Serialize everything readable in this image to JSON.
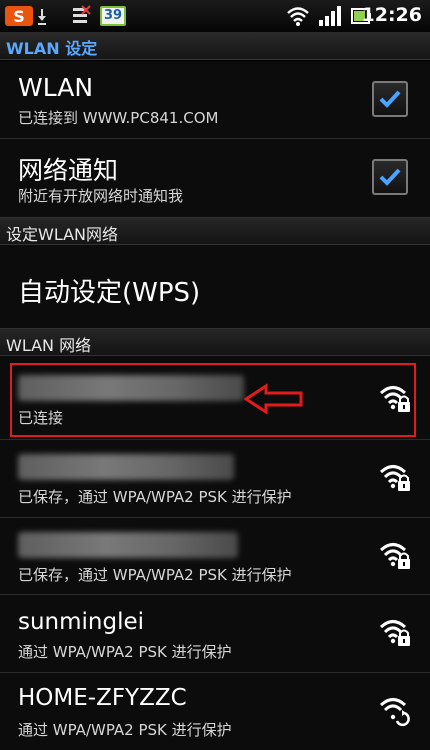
{
  "status_bar": {
    "notification_badge": "39",
    "time": "12:26"
  },
  "title_bar": {
    "title": "WLAN 设定"
  },
  "settings": [
    {
      "title": "WLAN",
      "subtitle": "已连接到 WWW.PC841.COM",
      "checked": true
    },
    {
      "title": "网络通知",
      "subtitle": "附近有开放网络时通知我",
      "checked": true
    }
  ],
  "section_configure": "设定WLAN网络",
  "wps": {
    "title": "自动设定(WPS)"
  },
  "section_networks": "WLAN 网络",
  "networks": [
    {
      "name": "",
      "status": "已连接",
      "locked": true,
      "blurred": true,
      "highlighted": true
    },
    {
      "name": "",
      "status": "已保存，通过 WPA/WPA2 PSK 进行保护",
      "locked": true,
      "blurred": true
    },
    {
      "name": "",
      "status": "已保存，通过 WPA/WPA2 PSK 进行保护",
      "locked": true,
      "blurred": true
    },
    {
      "name": "sunminglei",
      "status": "通过 WPA/WPA2 PSK 进行保护",
      "locked": true,
      "blurred": false
    },
    {
      "name": "HOME-ZFYZZC",
      "status": "通过 WPA/WPA2 PSK 进行保护",
      "locked": true,
      "blurred": false
    }
  ],
  "colors": {
    "accent": "#5aa9ff",
    "check": "#4aa3ff",
    "highlight": "#e01c1c"
  }
}
